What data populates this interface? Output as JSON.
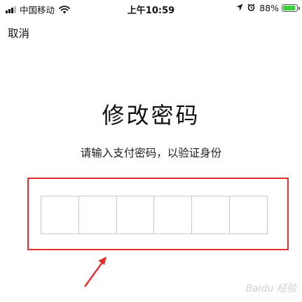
{
  "status_bar": {
    "carrier": "中国移动",
    "time": "上午10:59",
    "battery_percent": "88%",
    "battery_level": 0.88,
    "accent_battery": "#3ecf3e"
  },
  "nav": {
    "cancel_label": "取消"
  },
  "main": {
    "title": "修改密码",
    "subtitle": "请输入支付密码，以验证身份",
    "pin_length": 6
  },
  "annotation": {
    "highlight_color": "#e03030",
    "watermark": "Baidu 经验"
  },
  "icons": [
    "signal-icon",
    "wifi-icon",
    "location-icon",
    "alarm-icon",
    "battery-icon",
    "arrow-icon"
  ]
}
